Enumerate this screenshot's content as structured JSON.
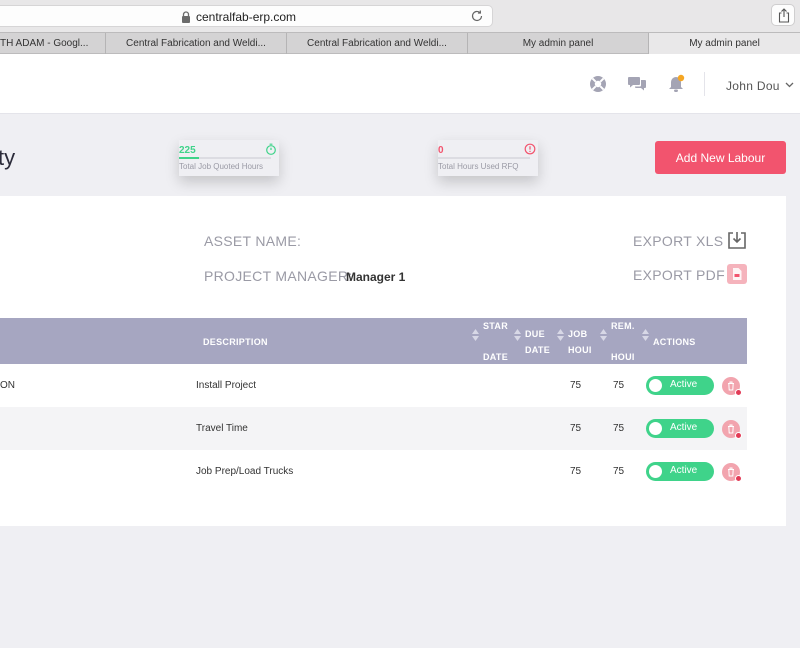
{
  "browser": {
    "url": "centralfab-erp.com",
    "tabs": [
      {
        "label": "TH ADAM - Googl...",
        "active": false
      },
      {
        "label": "Central Fabrication and Weldi...",
        "active": false
      },
      {
        "label": "Central Fabrication and Weldi...",
        "active": false
      },
      {
        "label": "My admin panel",
        "active": false
      },
      {
        "label": "My admin panel",
        "active": true
      }
    ]
  },
  "header": {
    "user_name": "John Dou",
    "icons": [
      "support-icon",
      "chat-icon",
      "notification-bell-icon"
    ],
    "notification_dot_color": "#f5a623"
  },
  "page": {
    "title_fragment": "ty"
  },
  "stats": [
    {
      "value": "225",
      "label": "Total Job Quoted Hours",
      "color": "#3fd38a",
      "icon": "stopwatch-icon",
      "fill_fraction": 0.22
    },
    {
      "value": "0",
      "label": "Total Hours Used RFQ",
      "color": "#f2546e",
      "icon": "alert-circle-icon",
      "fill_fraction": 0
    }
  ],
  "actions": {
    "add_labour": "Add New Labour",
    "export_xls": "EXPORT XLS",
    "export_pdf": "EXPORT PDF"
  },
  "meta": {
    "asset_name_label": "ASSET NAME:",
    "asset_name_value": "",
    "project_manager_label": "PROJECT MANAGER:",
    "project_manager_value": "Manager 1"
  },
  "table": {
    "headers": {
      "description": "DESCRIPTION",
      "start_top": "STAR",
      "start_bottom": "DATE",
      "due_top": "DUE",
      "due_bottom": "DATE",
      "job_top": "JOB",
      "job_bottom": "HOUI",
      "rem_top": "REM.",
      "rem_bottom": "HOUI",
      "actions": "ACTIONS"
    },
    "rows": [
      {
        "first_col": "ON",
        "description": "Install Project",
        "start_date": "",
        "due_date": "",
        "job_hours": "75",
        "rem_hours": "75",
        "status": "Active"
      },
      {
        "first_col": "",
        "description": "Travel Time",
        "start_date": "",
        "due_date": "",
        "job_hours": "75",
        "rem_hours": "75",
        "status": "Active"
      },
      {
        "first_col": "",
        "description": "Job Prep/Load Trucks",
        "start_date": "",
        "due_date": "",
        "job_hours": "75",
        "rem_hours": "75",
        "status": "Active"
      }
    ]
  },
  "colors": {
    "accent": "#f2546e",
    "active": "#3fd38a",
    "table_header": "#a6a6c1"
  }
}
